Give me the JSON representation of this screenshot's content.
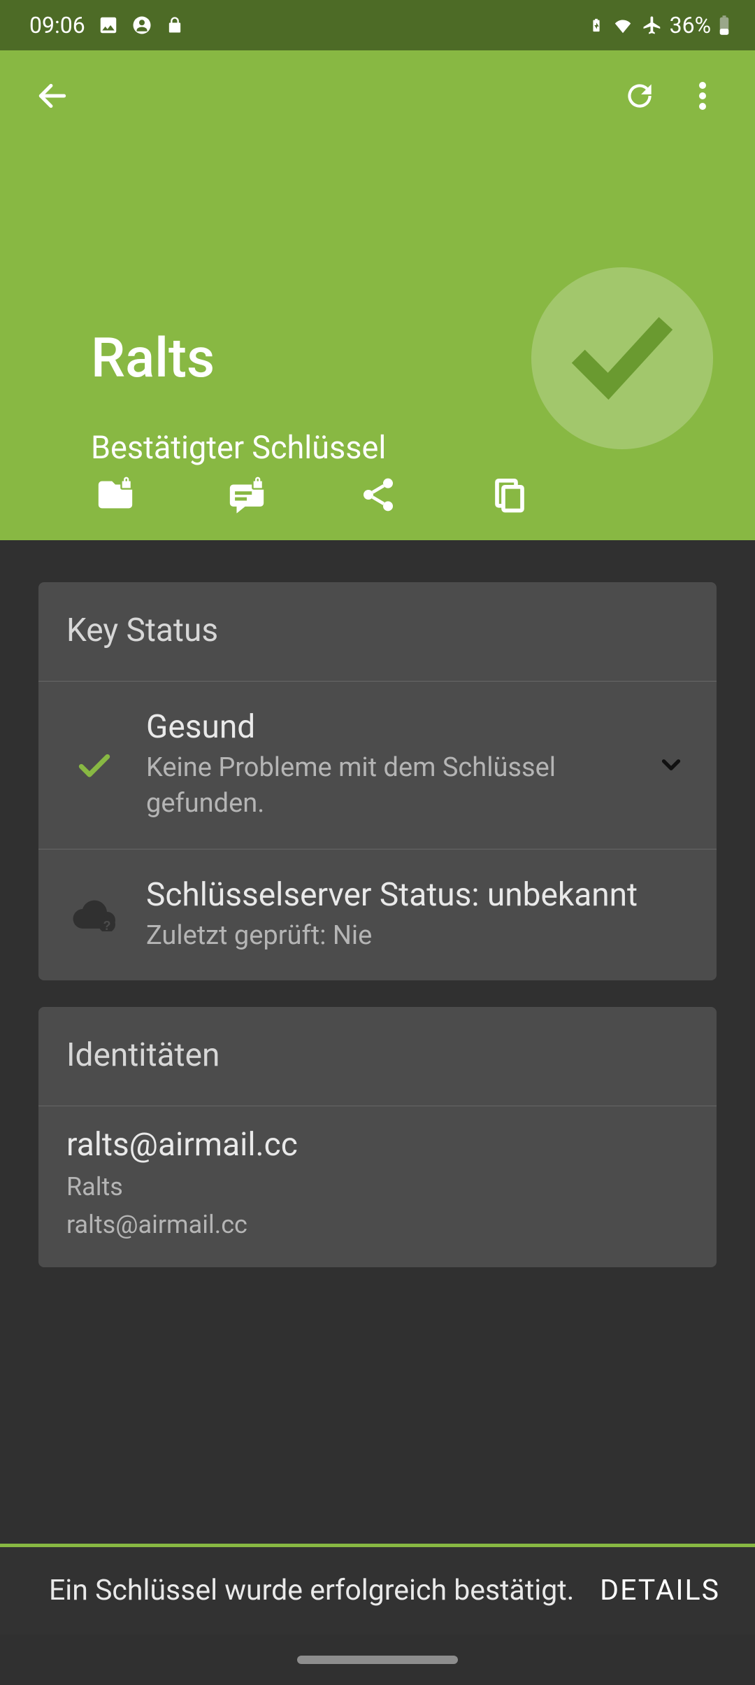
{
  "status_bar": {
    "time": "09:06",
    "battery_percent": "36%"
  },
  "header": {
    "title": "Ralts",
    "subtitle": "Bestätigter Schlüssel"
  },
  "key_status": {
    "header": "Key Status",
    "health": {
      "title": "Gesund",
      "subtitle": "Keine Probleme mit dem Schlüssel gefunden."
    },
    "server": {
      "title": "Schlüsselserver Status: unbekannt",
      "subtitle": "Zuletzt geprüft: Nie"
    }
  },
  "identities": {
    "header": "Identitäten",
    "items": [
      {
        "primary": "ralts@airmail.cc",
        "name": "Ralts",
        "email": "ralts@airmail.cc"
      }
    ]
  },
  "snackbar": {
    "message": "Ein Schlüssel wurde erfolgreich bestätigt.",
    "action": "DETAILS"
  },
  "colors": {
    "accent": "#88b843",
    "status_bar": "#4d6b26"
  }
}
